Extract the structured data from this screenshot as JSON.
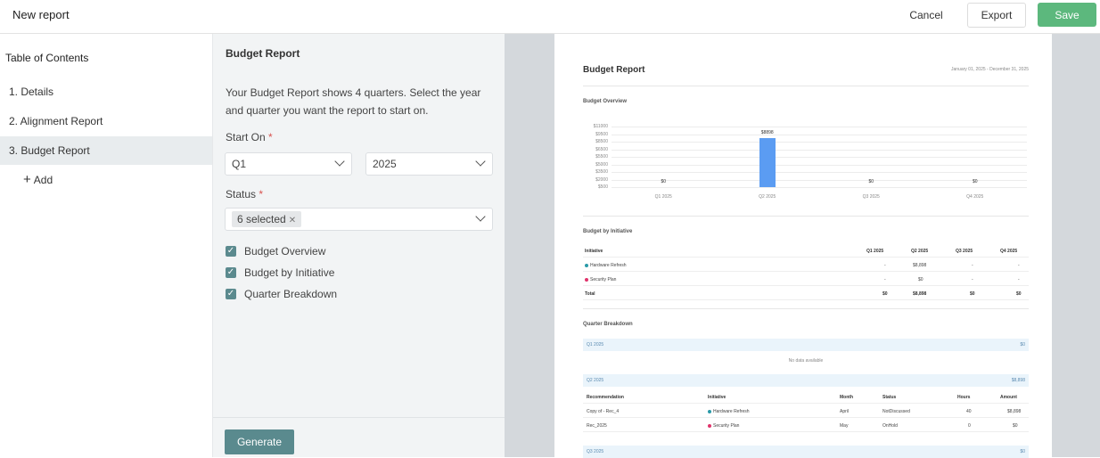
{
  "header": {
    "title": "New report",
    "cancel": "Cancel",
    "export": "Export",
    "save": "Save"
  },
  "toc": {
    "title": "Table of Contents",
    "items": [
      {
        "label": "1. Details"
      },
      {
        "label": "2. Alignment Report"
      },
      {
        "label": "3. Budget Report"
      }
    ],
    "add_label": "Add"
  },
  "form": {
    "title": "Budget Report",
    "description": "Your Budget Report shows 4 quarters. Select the year and quarter you want the report to start on.",
    "start_on_label": "Start On",
    "quarter_value": "Q1",
    "year_value": "2025",
    "status_label": "Status",
    "status_chip": "6 selected",
    "checkboxes": [
      {
        "label": "Budget Overview",
        "checked": true
      },
      {
        "label": "Budget by Initiative",
        "checked": true
      },
      {
        "label": "Quarter Breakdown",
        "checked": true
      }
    ],
    "generate": "Generate"
  },
  "preview": {
    "title": "Budget Report",
    "date_range": "January 01, 2025 - December 31, 2025",
    "overview_title": "Budget Overview",
    "y_ticks": [
      "$11000",
      "$9500",
      "$8500",
      "$6500",
      "$5500",
      "$5000",
      "$3500",
      "$2000",
      "$500"
    ],
    "by_initiative_title": "Budget by Initiative",
    "initiative_header": [
      "Initiative",
      "Q1 2025",
      "Q2 2025",
      "Q3 2025",
      "Q4 2025"
    ],
    "initiative_rows": [
      {
        "name": "Hardware Refresh",
        "dot": "#2a9aa8",
        "q1": "-",
        "q2": "$8,898",
        "q3": "-",
        "q4": "-"
      },
      {
        "name": "Security Plan",
        "dot": "#e0336b",
        "q1": "-",
        "q2": "$0",
        "q3": "-",
        "q4": "-"
      },
      {
        "name": "Total",
        "q1": "$0",
        "q2": "$8,898",
        "q3": "$0",
        "q4": "$0"
      }
    ],
    "quarter_breakdown_title": "Quarter Breakdown",
    "q1_band": {
      "label": "Q1 2025",
      "amount": "$0"
    },
    "no_data": "No data available",
    "q2_band": {
      "label": "Q2 2025",
      "amount": "$8,898"
    },
    "rec_header": [
      "Recommendation",
      "Initiative",
      "Month",
      "Status",
      "Hours",
      "Amount"
    ],
    "rec_rows": [
      {
        "rec": "Copy of - Rec_4",
        "initiative": "Hardware Refresh",
        "dot": "#2a9aa8",
        "month": "April",
        "status": "NotDiscussed",
        "hours": "40",
        "amount": "$8,898"
      },
      {
        "rec": "Rec_2025",
        "initiative": "Security Plan",
        "dot": "#e0336b",
        "month": "May",
        "status": "OnHold",
        "hours": "0",
        "amount": "$0"
      }
    ],
    "q3_band": {
      "label": "Q3 2025",
      "amount": "$0"
    }
  },
  "chart_data": {
    "type": "bar",
    "title": "Budget Overview",
    "categories": [
      "Q1 2025",
      "Q2 2025",
      "Q3 2025",
      "Q4 2025"
    ],
    "values": [
      0,
      8898,
      0,
      0
    ],
    "value_labels": [
      "$0",
      "$8898",
      "$0",
      "$0"
    ],
    "ylim": [
      0,
      11000
    ],
    "bar_color": "#5b9cf2",
    "grid": true
  }
}
